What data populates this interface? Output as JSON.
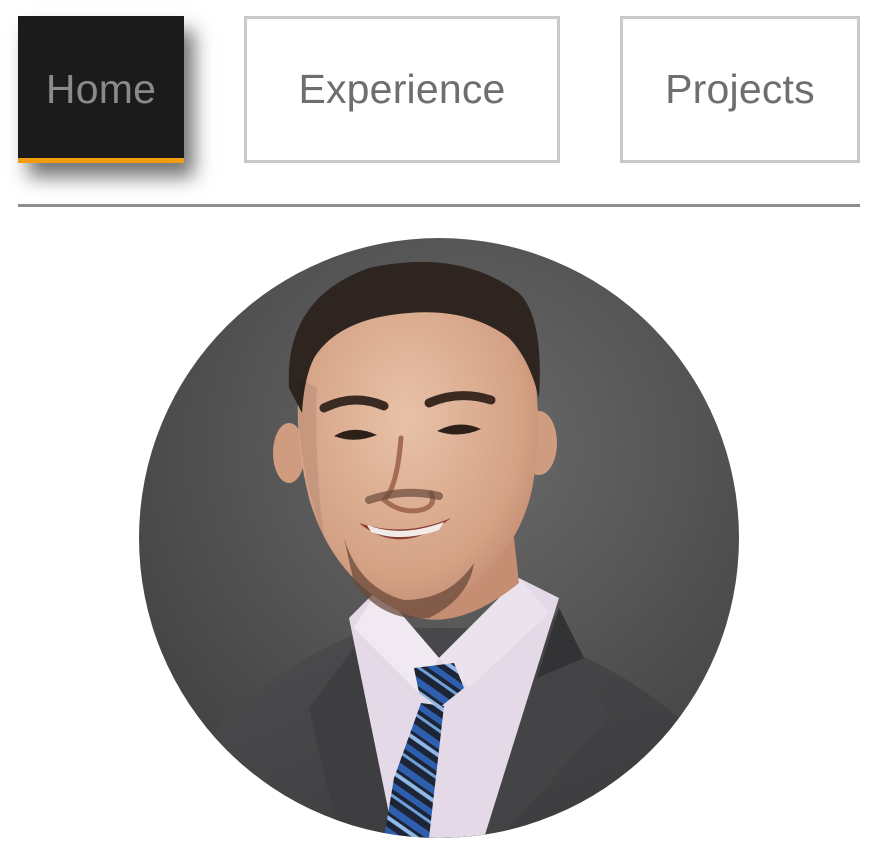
{
  "nav": {
    "items": [
      {
        "label": "Home",
        "active": true
      },
      {
        "label": "Experience",
        "active": false
      },
      {
        "label": "Projects",
        "active": false
      }
    ]
  },
  "colors": {
    "active_bg": "#1b1b1b",
    "active_text": "#8a8a8a",
    "active_underline": "#f39c12",
    "outline_border": "#c9c9c9",
    "outline_text": "#6e6e6e",
    "divider": "#8e8e8e"
  },
  "profile": {
    "image": "profile-photo"
  }
}
